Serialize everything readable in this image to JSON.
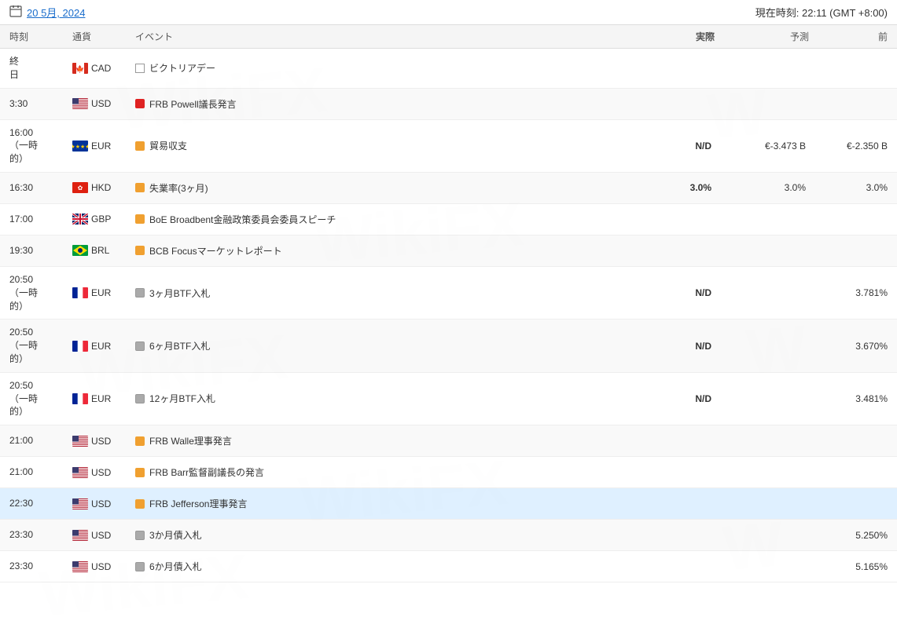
{
  "header": {
    "date_label": "20 5月, 2024",
    "calendar_icon": "calendar",
    "time_label": "現在時刻: 22:11 (GMT +8:00)"
  },
  "columns": {
    "time": "時刻",
    "currency": "通貨",
    "event": "イベント",
    "actual": "実際",
    "forecast": "予測",
    "prev": "前"
  },
  "rows": [
    {
      "time": "終\n日",
      "currency": "CAD",
      "flag": "ca",
      "importance": "empty",
      "event": "ビクトリアデー",
      "actual": "",
      "forecast": "",
      "prev": "",
      "highlighted": false,
      "alt": false
    },
    {
      "time": "3:30",
      "currency": "USD",
      "flag": "us",
      "importance": "red",
      "event": "FRB Powell議長発言",
      "actual": "",
      "forecast": "",
      "prev": "",
      "highlighted": false,
      "alt": true
    },
    {
      "time": "16:00\n（一時\n的）",
      "currency": "EUR",
      "flag": "eu",
      "importance": "orange",
      "event": "貿易収支",
      "actual": "N/D",
      "forecast": "€-3.473 B",
      "prev": "€-2.350 B",
      "highlighted": false,
      "alt": false
    },
    {
      "time": "16:30",
      "currency": "HKD",
      "flag": "hk",
      "importance": "orange",
      "event": "失業率(3ヶ月)",
      "actual": "3.0%",
      "forecast": "3.0%",
      "prev": "3.0%",
      "highlighted": false,
      "alt": true
    },
    {
      "time": "17:00",
      "currency": "GBP",
      "flag": "gb",
      "importance": "orange",
      "event": "BoE Broadbent金融政策委員会委員スピーチ",
      "actual": "",
      "forecast": "",
      "prev": "",
      "highlighted": false,
      "alt": false
    },
    {
      "time": "19:30",
      "currency": "BRL",
      "flag": "br",
      "importance": "orange",
      "event": "BCB Focusマーケットレポート",
      "actual": "",
      "forecast": "",
      "prev": "",
      "highlighted": false,
      "alt": true
    },
    {
      "time": "20:50\n（一時\n的）",
      "currency": "EUR",
      "flag": "fr",
      "importance": "gray",
      "event": "3ヶ月BTF入札",
      "actual": "N/D",
      "forecast": "",
      "prev": "3.781%",
      "highlighted": false,
      "alt": false
    },
    {
      "time": "20:50\n（一時\n的）",
      "currency": "EUR",
      "flag": "fr",
      "importance": "gray",
      "event": "6ヶ月BTF入札",
      "actual": "N/D",
      "forecast": "",
      "prev": "3.670%",
      "highlighted": false,
      "alt": true
    },
    {
      "time": "20:50\n（一時\n的）",
      "currency": "EUR",
      "flag": "fr",
      "importance": "gray",
      "event": "12ヶ月BTF入札",
      "actual": "N/D",
      "forecast": "",
      "prev": "3.481%",
      "highlighted": false,
      "alt": false
    },
    {
      "time": "21:00",
      "currency": "USD",
      "flag": "us",
      "importance": "orange",
      "event": "FRB Walle理事発言",
      "actual": "",
      "forecast": "",
      "prev": "",
      "highlighted": false,
      "alt": true
    },
    {
      "time": "21:00",
      "currency": "USD",
      "flag": "us",
      "importance": "orange",
      "event": "FRB Barr監督副議長の発言",
      "actual": "",
      "forecast": "",
      "prev": "",
      "highlighted": false,
      "alt": false
    },
    {
      "time": "22:30",
      "currency": "USD",
      "flag": "us",
      "importance": "orange",
      "event": "FRB Jefferson理事発言",
      "actual": "",
      "forecast": "",
      "prev": "",
      "highlighted": true,
      "alt": false
    },
    {
      "time": "23:30",
      "currency": "USD",
      "flag": "us",
      "importance": "gray",
      "event": "3か月債入札",
      "actual": "",
      "forecast": "",
      "prev": "5.250%",
      "highlighted": false,
      "alt": true
    },
    {
      "time": "23:30",
      "currency": "USD",
      "flag": "us",
      "importance": "gray",
      "event": "6か月債入札",
      "actual": "",
      "forecast": "",
      "prev": "5.165%",
      "highlighted": false,
      "alt": false
    }
  ],
  "watermark": {
    "text": "WikiFX"
  }
}
